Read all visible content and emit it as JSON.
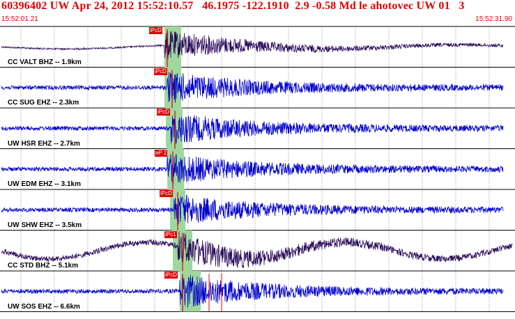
{
  "header": {
    "title": "60396402 UW Apr 24, 2012 15:52:10.57   46.1975 -122.1910  2.9 -0.58 Md le ahotovec UW 01   3",
    "time_start": "15:52:01.21",
    "time_end": "15:52:31.90"
  },
  "colors": {
    "accent": "#e00000",
    "trace_blue": "#0000cc",
    "trace_purple": "#2a0a5a",
    "pick_window": "#9fd89f"
  },
  "traces": [
    {
      "label": "CC VALT BHZ -- 1.9km",
      "pick": "iPcD",
      "color": "purple"
    },
    {
      "label": "CC SUG EHZ -- 2.3km",
      "pick": "iPcD",
      "color": "blue"
    },
    {
      "label": "UW HSR EHZ -- 2.7km",
      "pick": "iPcD",
      "color": "blue"
    },
    {
      "label": "UW EDM EHZ -- 3.1km",
      "pick": "eP 2",
      "color": "blue"
    },
    {
      "label": "UW SHW EHZ -- 3.5km",
      "pick": "iPcD",
      "color": "blue"
    },
    {
      "label": "CC STD BHZ -- 5.1km",
      "pick": "iPc1",
      "color": "purple"
    },
    {
      "label": "UW SOS EHZ -- 6.6km",
      "pick": "iPcD",
      "color": "blue"
    }
  ]
}
